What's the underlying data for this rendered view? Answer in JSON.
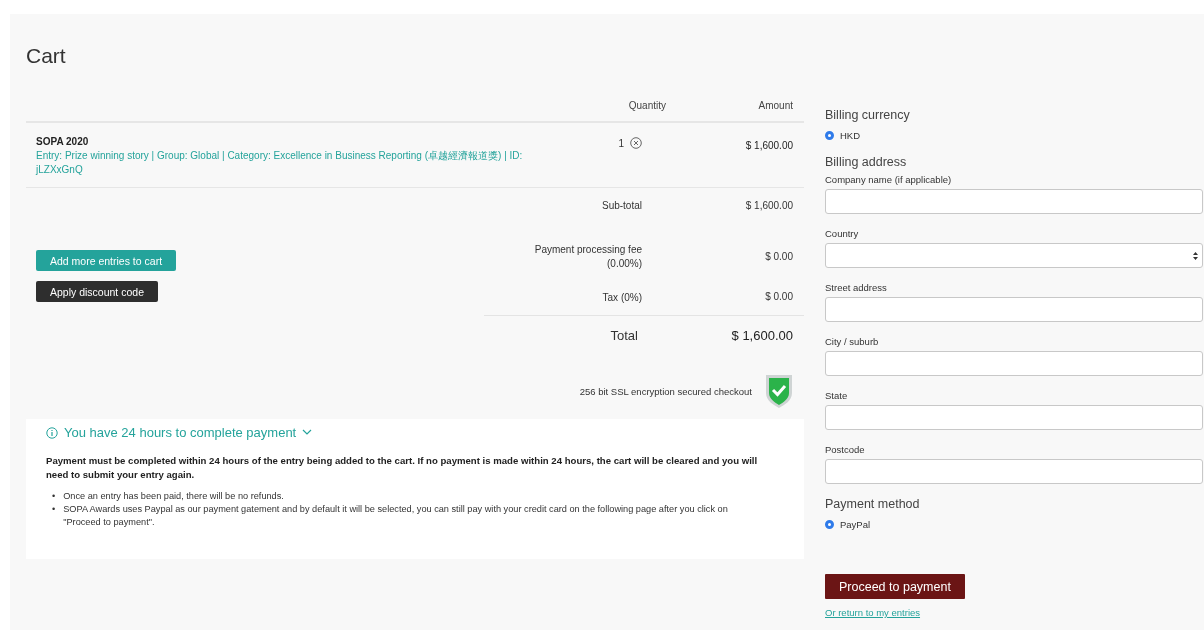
{
  "title": "Cart",
  "table": {
    "columns": [
      "Quantity",
      "Amount"
    ],
    "items": [
      {
        "name": "SOPA 2020",
        "details": "Entry: Prize winning story | Group: Global | Category: Excellence in Business Reporting (卓越經濟報道獎) | ID: jLZXxGnQ",
        "quantity": "1",
        "amount": "$ 1,600.00"
      }
    ]
  },
  "subtotal": {
    "label": "Sub-total",
    "value": "$ 1,600.00"
  },
  "buttons": [
    {
      "label": "Add more entries to cart",
      "kind": "primary"
    },
    {
      "label": "Apply discount code",
      "kind": "dark"
    }
  ],
  "fees": [
    {
      "label": "Payment processing fee",
      "sub": "(0.00%)",
      "value": "$ 0.00"
    },
    {
      "label": "Tax (0%)",
      "value": "$ 0.00"
    }
  ],
  "total": {
    "label": "Total",
    "value": "$ 1,600.00"
  },
  "ssl_note": "256 bit SSL encryption secured checkout",
  "notice": {
    "title": "You have 24 hours to complete payment",
    "expanded": true,
    "lead": "Payment must be completed within 24 hours of the entry being added to the cart. If no payment is made within 24 hours, the cart will be cleared and you will need to submit your entry again.",
    "points": [
      {
        "bullet": "•",
        "text": "Once an entry has been paid, there will be no refunds."
      },
      {
        "bullet": "•",
        "text": "SOPA Awards uses Paypal as our payment gatement and by default it will be selected, you can still pay with your credit card on the following page after you click on \"Proceed to payment\"."
      }
    ]
  },
  "billing_currency": {
    "heading": "Billing currency",
    "options": [
      {
        "label": "HKD",
        "selected": true
      }
    ]
  },
  "billing_address": {
    "heading": "Billing address",
    "fields": [
      {
        "label": "Company name (if applicable)",
        "kind": "text"
      },
      {
        "label": "Country",
        "kind": "select"
      },
      {
        "label": "Street address",
        "kind": "text"
      },
      {
        "label": "City / suburb",
        "kind": "text"
      },
      {
        "label": "State",
        "kind": "text"
      },
      {
        "label": "Postcode",
        "kind": "text"
      }
    ]
  },
  "payment_method": {
    "heading": "Payment method",
    "options": [
      {
        "label": "PayPal",
        "selected": true
      }
    ]
  },
  "submit": "Proceed to payment",
  "return_link": "Or return to my entries"
}
